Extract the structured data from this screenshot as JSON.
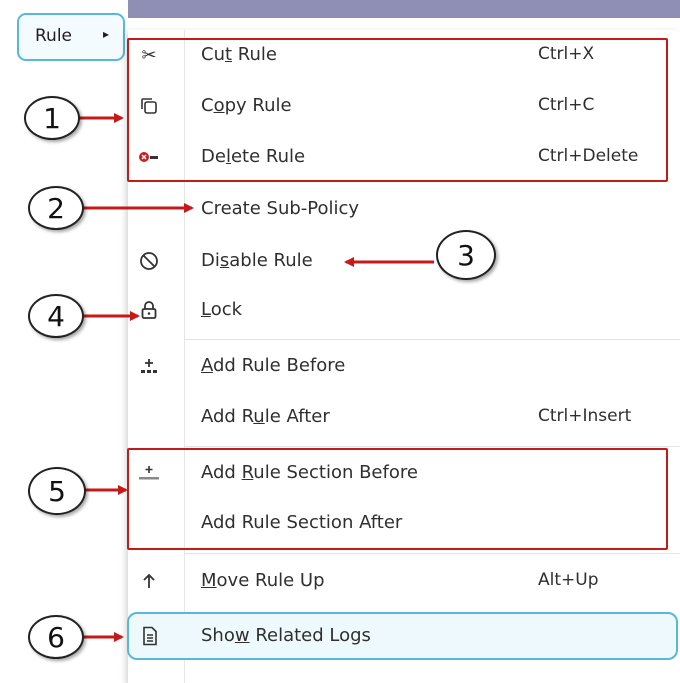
{
  "rule_button": {
    "label": "Rule"
  },
  "menu": {
    "items": [
      {
        "name": "cut-rule",
        "pre": "Cu",
        "u": "t",
        "post": " Rule",
        "shortcut": "Ctrl+X",
        "icon": "scissors-icon"
      },
      {
        "name": "copy-rule",
        "pre": "C",
        "u": "o",
        "post": "py Rule",
        "shortcut": "Ctrl+C",
        "icon": "copy-icon"
      },
      {
        "name": "delete-rule",
        "pre": "De",
        "u": "l",
        "post": "ete Rule",
        "shortcut": "Ctrl+Delete",
        "icon": "delete-rule-icon"
      },
      {
        "name": "create-sub-policy",
        "pre": "Create Sub-Policy",
        "u": "",
        "post": "",
        "shortcut": "",
        "icon": ""
      },
      {
        "name": "disable-rule",
        "pre": "Di",
        "u": "s",
        "post": "able Rule",
        "shortcut": "",
        "icon": "disable-icon"
      },
      {
        "name": "lock",
        "pre": "",
        "u": "L",
        "post": "ock",
        "shortcut": "",
        "icon": "lock-icon"
      },
      {
        "name": "add-rule-before",
        "pre": "",
        "u": "A",
        "post": "dd Rule Before",
        "shortcut": "",
        "icon": "add-rule-icon"
      },
      {
        "name": "add-rule-after",
        "pre": "Add R",
        "u": "u",
        "post": "le After",
        "shortcut": "Ctrl+Insert",
        "icon": ""
      },
      {
        "name": "add-rule-section-before",
        "pre": "Add ",
        "u": "R",
        "post": "ule Section Before",
        "shortcut": "",
        "icon": "add-section-icon"
      },
      {
        "name": "add-rule-section-after",
        "pre": "Add Rule Section After",
        "u": "",
        "post": "",
        "shortcut": "",
        "icon": ""
      },
      {
        "name": "move-rule-up",
        "pre": "",
        "u": "M",
        "post": "ove Rule Up",
        "shortcut": "Alt+Up",
        "icon": "arrow-up-icon"
      },
      {
        "name": "show-related-logs",
        "pre": "Sho",
        "u": "w",
        "post": " Related Logs",
        "shortcut": "",
        "icon": "logs-document-icon"
      }
    ]
  },
  "callouts": [
    "1",
    "2",
    "3",
    "4",
    "5",
    "6"
  ],
  "colors": {
    "annotation_red": "#c41a1a",
    "highlight_blue": "#59b8d8",
    "header_bar": "#8f8fb6"
  }
}
